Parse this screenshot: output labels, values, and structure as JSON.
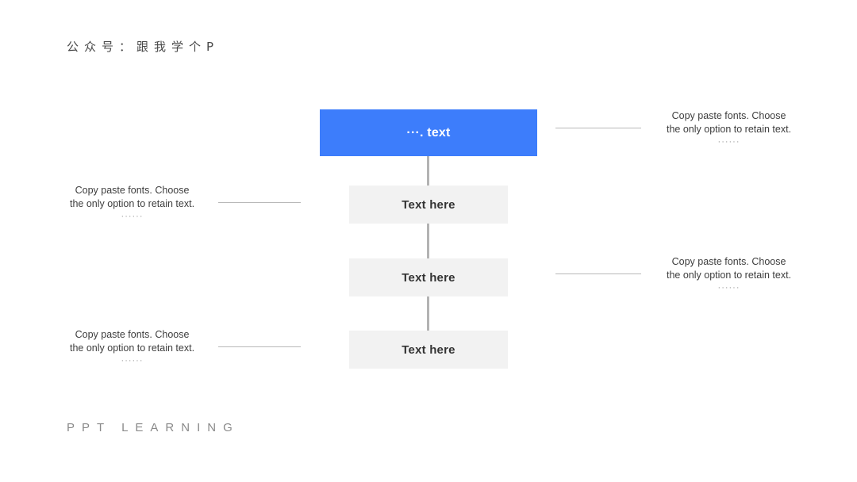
{
  "header": {
    "title": "公众号：跟我学个P"
  },
  "footer": {
    "brand": "PPT LEARNING"
  },
  "colors": {
    "primary_blue": "#3d7dfb",
    "node_gray": "#f2f2f2",
    "connector_gray": "#b3b3b3",
    "leader_gray": "#b8b8b8",
    "text_dark": "#333333",
    "text_white": "#ffffff"
  },
  "flow": {
    "nodes": [
      {
        "label": "···. text",
        "style": "primary"
      },
      {
        "label": "Text here",
        "style": "secondary"
      },
      {
        "label": "Text here",
        "style": "secondary"
      },
      {
        "label": "Text here",
        "style": "secondary"
      }
    ]
  },
  "callouts": [
    {
      "side": "right",
      "line1": "Copy paste fonts. Choose",
      "line2": "the only option to retain text.",
      "dots": "······"
    },
    {
      "side": "right",
      "line1": "Copy paste fonts. Choose",
      "line2": "the only option to retain text.",
      "dots": "······"
    },
    {
      "side": "left",
      "line1": "Copy paste fonts. Choose",
      "line2": "the only option to retain text.",
      "dots": "······"
    },
    {
      "side": "left",
      "line1": "Copy paste fonts. Choose",
      "line2": "the only option to retain text.",
      "dots": "······"
    }
  ]
}
